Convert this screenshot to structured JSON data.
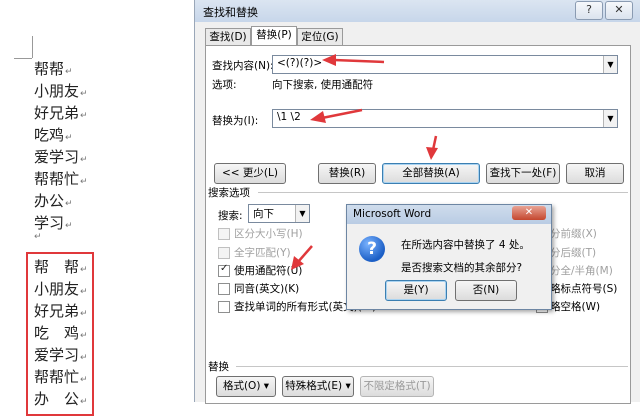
{
  "document": {
    "lines_top": [
      "帮帮",
      "小朋友",
      "好兄弟",
      "吃鸡",
      "爱学习",
      "帮帮忙",
      "办公",
      "学习"
    ],
    "lines_bottom": [
      "帮　帮",
      "小朋友",
      "好兄弟",
      "吃　鸡",
      "爱学习",
      "帮帮忙",
      "办　公"
    ],
    "para_mark": "↵"
  },
  "dialog": {
    "title": "查找和替换",
    "help_label": "?",
    "close_label": "✕",
    "tabs": [
      "查找(D)",
      "替换(P)",
      "定位(G)"
    ],
    "find_label": "查找内容(N):",
    "find_value": "<(?)(?)>",
    "options_label": "选项:",
    "options_value": "向下搜索, 使用通配符",
    "replace_label": "替换为(I):",
    "replace_value": "\\1  \\2",
    "buttons": {
      "less": "<< 更少(L)",
      "replace": "替换(R)",
      "replace_all": "全部替换(A)",
      "find_next": "查找下一处(F)",
      "cancel": "取消"
    },
    "search_options_title": "搜索选项",
    "search_label": "搜索:",
    "search_value": "向下",
    "checkboxes": [
      {
        "label": "区分大小写(H)",
        "checked": false,
        "enabled": false
      },
      {
        "label": "全字匹配(Y)",
        "checked": false,
        "enabled": false
      },
      {
        "label": "使用通配符(U)",
        "checked": true,
        "enabled": true
      },
      {
        "label": "同音(英文)(K)",
        "checked": false,
        "enabled": true
      },
      {
        "label": "查找单词的所有形式(英文)(W)",
        "checked": false,
        "enabled": true
      }
    ],
    "right_options_partial": [
      "分前缀(X)",
      "分后缀(T)",
      "分全/半角(M)",
      "略标点符号(S)",
      "略空格(W)"
    ],
    "replace_section_title": "替换",
    "bottom_buttons": {
      "format": "格式(O) ▾",
      "special": "特殊格式(E) ▾",
      "no_format": "不限定格式(T)"
    }
  },
  "message_box": {
    "title": "Microsoft Word",
    "close_label": "✕",
    "icon_glyph": "?",
    "line1": "在所选内容中替换了 4 处。",
    "line2": "是否搜索文档的其余部分?",
    "yes": "是(Y)",
    "no": "否(N)"
  },
  "colors": {
    "annotation_red": "#e0383b",
    "title_blue": "#c7d6ea"
  }
}
